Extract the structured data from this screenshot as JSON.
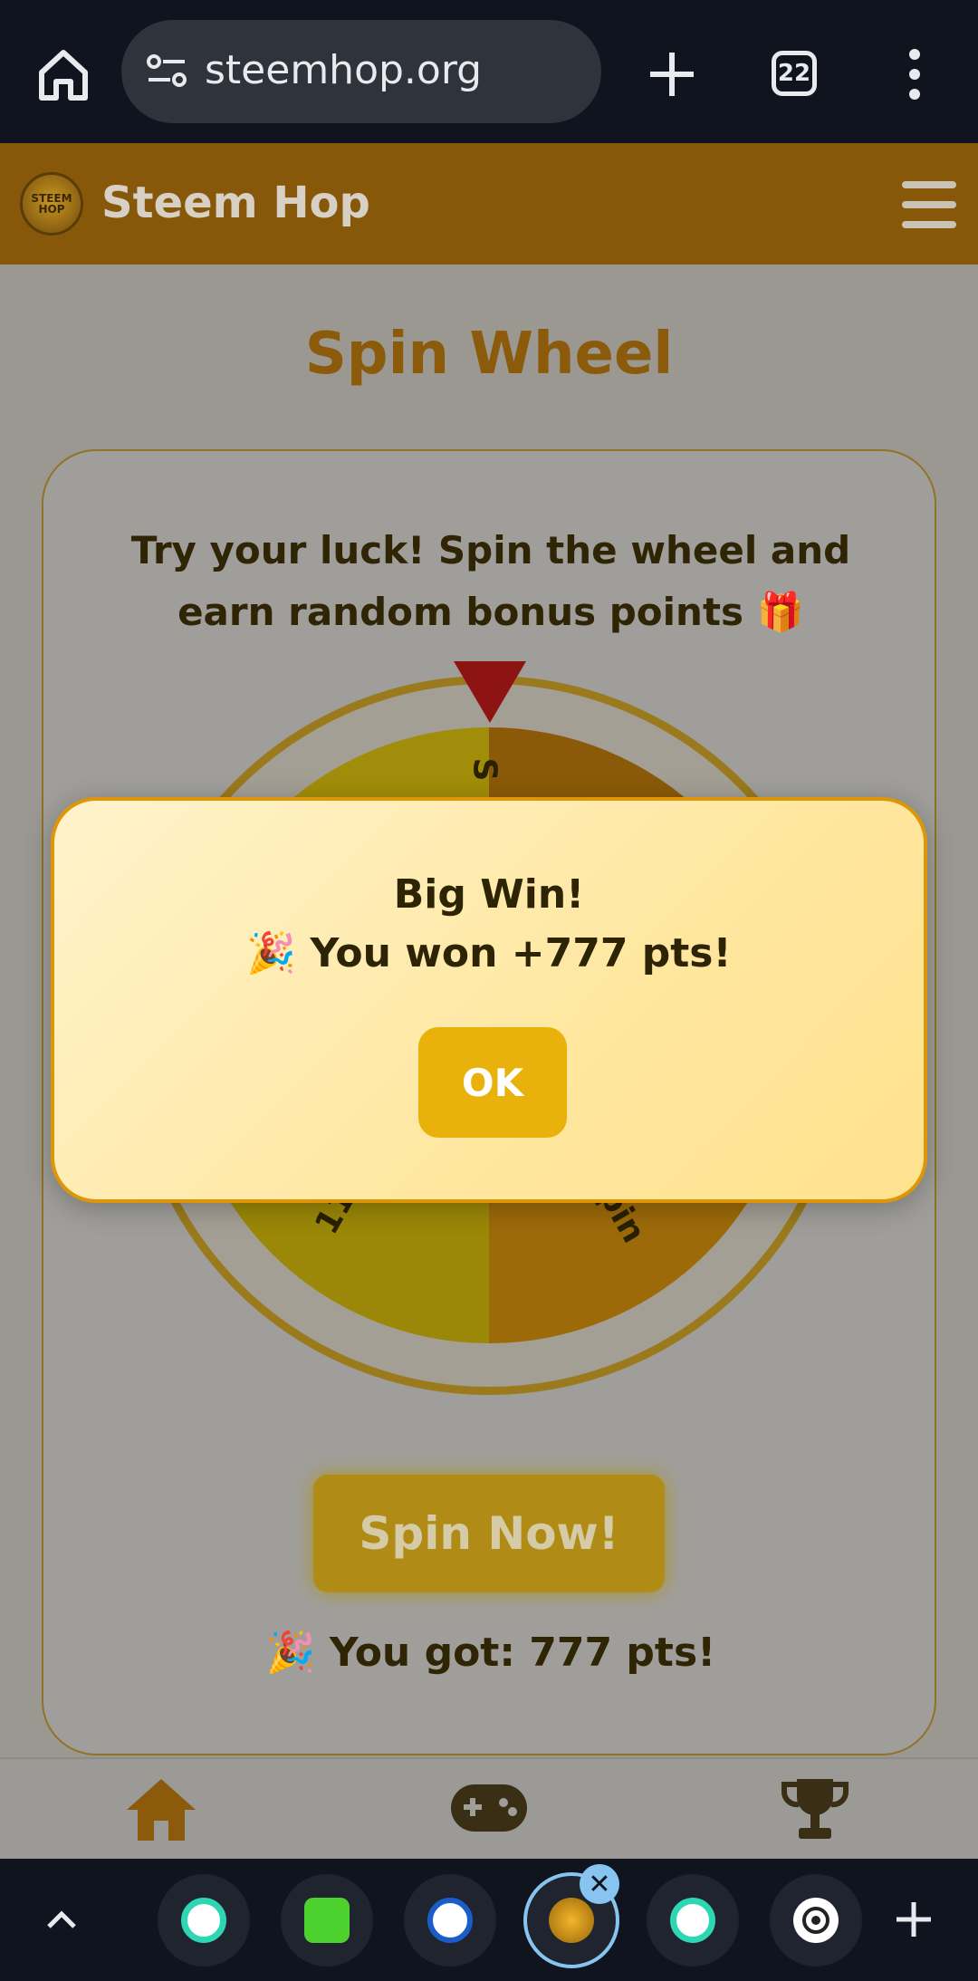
{
  "browser": {
    "url": "steemhop.org",
    "tab_count": "22"
  },
  "site": {
    "title": "Steem Hop",
    "logo_text": "STEEM HOP"
  },
  "page": {
    "title": "Spin Wheel",
    "intro": "Try your luck! Spin the wheel and earn random bonus points 🎁",
    "wheel": {
      "segments_visible": [
        "S",
        "111 pts",
        "Freespin"
      ]
    },
    "spin_button_label": "Spin Now!",
    "result_text": "🎉 You got: 777 pts!"
  },
  "modal": {
    "title": "Big Win!",
    "message": "🎉 You won +777 pts!",
    "ok_label": "OK"
  },
  "bottom_nav": {
    "items": [
      {
        "icon": "home-icon"
      },
      {
        "icon": "gamepad-icon"
      },
      {
        "icon": "trophy-icon"
      }
    ]
  },
  "tab_bar": {
    "tabs": [
      {
        "icon": "chat-teal-icon"
      },
      {
        "icon": "play-green-icon"
      },
      {
        "icon": "steem-icon"
      },
      {
        "icon": "steemhop-icon",
        "active": true
      },
      {
        "icon": "chat-teal-icon"
      },
      {
        "icon": "openai-icon"
      }
    ]
  },
  "colors": {
    "header_bg": "#87580a",
    "title_orange": "#8b5a0b",
    "modal_border": "#dc9608",
    "ok_button": "#e8b10c"
  }
}
